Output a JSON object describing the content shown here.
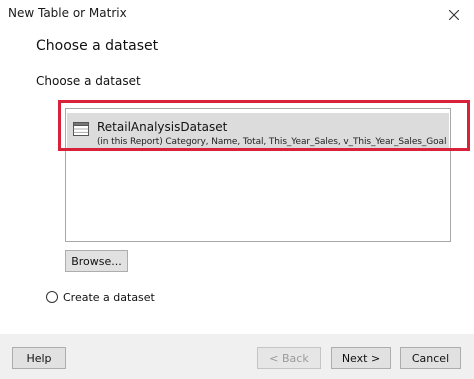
{
  "window": {
    "title": "New Table or Matrix"
  },
  "page": {
    "heading": "Choose a dataset",
    "section_label": "Choose a dataset"
  },
  "datasets": [
    {
      "name": "RetailAnalysisDataset",
      "detail": "(in  this  Report)  Category,  Name, Total,  This_Year_Sales,  v_This_Year_Sales_Goal",
      "selected": true,
      "icon": "table-icon"
    }
  ],
  "buttons": {
    "browse": "Browse...",
    "help": "Help",
    "back": "< Back",
    "next": "Next >",
    "cancel": "Cancel"
  },
  "radio": {
    "create_dataset_label": "Create a dataset",
    "checked": false
  },
  "colors": {
    "highlight": "#d8213a",
    "selected_row": "#dcdcdc",
    "footer_bg": "#f0f0f0"
  }
}
